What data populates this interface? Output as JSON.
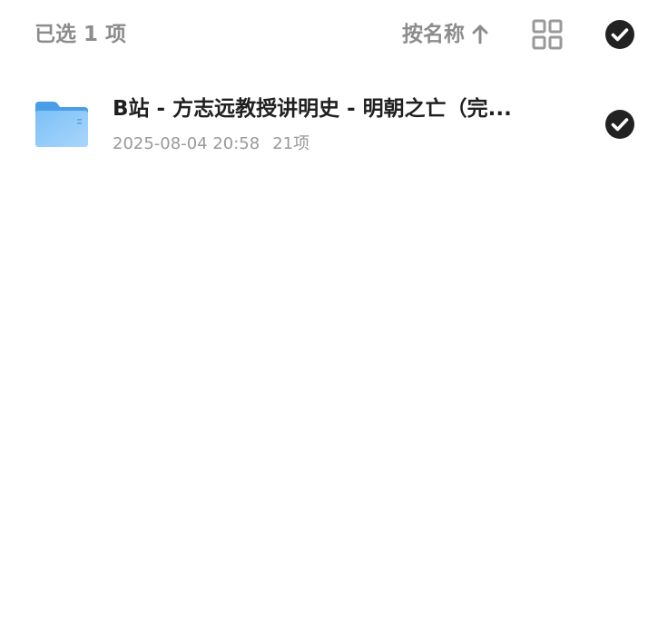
{
  "header": {
    "selected_text": "已选 1 项",
    "sort_label": "按名称",
    "sort_direction_icon": "arrow-up-icon",
    "view_toggle_icon": "grid-view-icon",
    "select_all_icon": "check-circle-icon",
    "select_all_checked": true
  },
  "files": [
    {
      "name": "B站 - 方志远教授讲明史 - 明朝之亡（完...",
      "date": "2025-08-04 20:58",
      "count": "21项",
      "type_icon": "folder-icon",
      "checked": true
    }
  ],
  "colors": {
    "folder_blue": "#5aaaf0",
    "check_fill": "#222222",
    "muted_text": "#8c8c8c"
  }
}
